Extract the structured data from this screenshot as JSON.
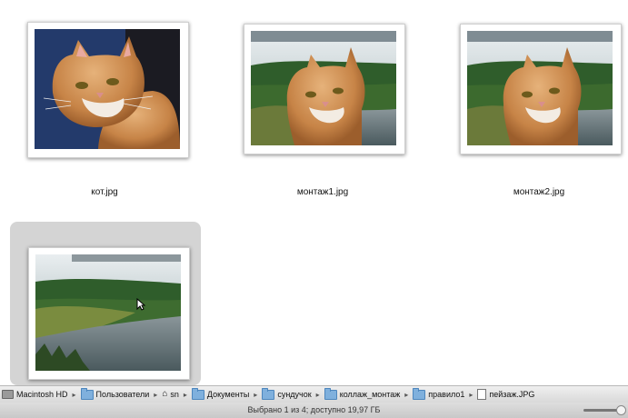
{
  "files": [
    {
      "name": "кот.jpg",
      "image": "cat-photo",
      "selected": false
    },
    {
      "name": "монтаж1.jpg",
      "image": "cat-landscape-montage",
      "selected": false
    },
    {
      "name": "монтаж2.jpg",
      "image": "cat-landscape-montage",
      "selected": false
    },
    {
      "name": "пейзаж.JPG",
      "image": "landscape-photo",
      "selected": true
    }
  ],
  "path_bar": {
    "crumbs": [
      {
        "label": "Macintosh HD",
        "icon": "disk-icon"
      },
      {
        "label": "Пользователи",
        "icon": "folder-icon"
      },
      {
        "label": "sn",
        "icon": "home-icon"
      },
      {
        "label": "Документы",
        "icon": "folder-icon"
      },
      {
        "label": "сундучок",
        "icon": "folder-icon"
      },
      {
        "label": "коллаж_монтаж",
        "icon": "folder-icon"
      },
      {
        "label": "правило1",
        "icon": "folder-icon"
      },
      {
        "label": "пейзаж.JPG",
        "icon": "file-icon"
      }
    ]
  },
  "status": {
    "text": "Выбрано 1 из 4; доступно 19,97 ГБ"
  }
}
